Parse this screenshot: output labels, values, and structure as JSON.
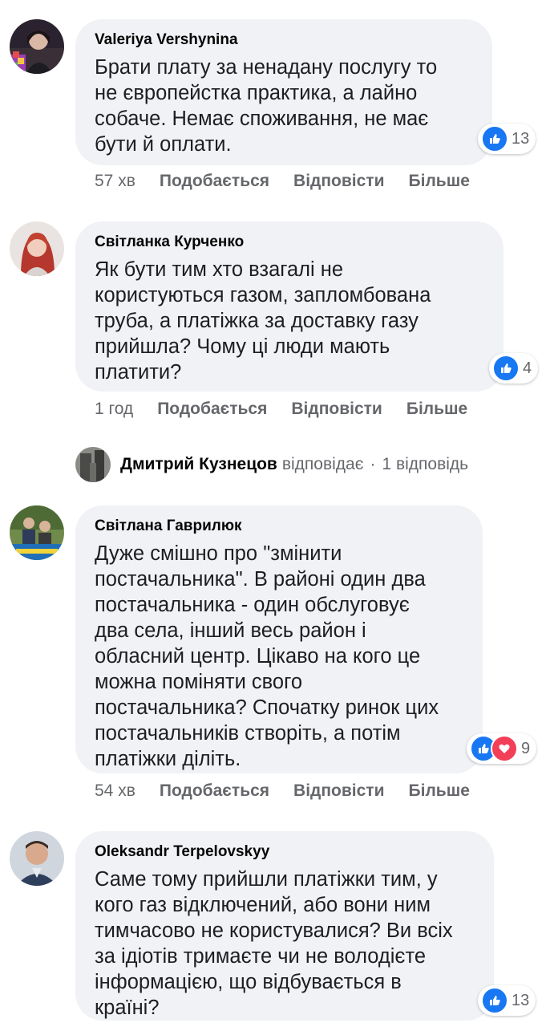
{
  "comments": [
    {
      "author": "Valeriya Vershynina",
      "text": "Брати плату за ненадану послугу то\nне європейстка практика, а лайно\nсобаче. Немає споживання, не має\nбути й оплати.",
      "reaction_count": "13",
      "reactions": [
        "like-icon"
      ],
      "time": "57 хв",
      "like": "Подобається",
      "reply": "Відповісти",
      "more": "Більше"
    },
    {
      "author": "Світланка Курченко",
      "text": "Як бути тим хто взагалі не\nкористуються газом, запломбована\nтруба, а платіжка за доставку газу\nприйшла? Чому ці люди мають\nплатити?",
      "reaction_count": "4",
      "reactions": [
        "like-icon"
      ],
      "time": "1 год",
      "like": "Подобається",
      "reply": "Відповісти",
      "more": "Більше"
    },
    {
      "author": "Світлана Гаврилюк",
      "text": "Дуже смішно про \"змінити\nпостачальника\". В районі один два\nпостачальника - один обслуговує\nдва села, інший весь район і\nобласний центр. Цікаво на кого це\nможна поміняти свого\nпостачальника? Спочатку ринок цих\nпостачальників створіть, а потім\nплатіжки діліть.",
      "reaction_count": "9",
      "reactions": [
        "like-icon",
        "love-icon"
      ],
      "time": "54 хв",
      "like": "Подобається",
      "reply": "Відповісти",
      "more": "Більше"
    },
    {
      "author": "Oleksandr Terpelovskyy",
      "text": "Саме тому прийшли платіжки тим, у\nкого газ відключений, або вони ним\nтимчасово не користувалися? Ви всіх\nза ідіотів тримаєте чи не володієте\nінформацією, що відбувається в\nкраїні?",
      "reaction_count": "13",
      "reactions": [
        "like-icon"
      ]
    }
  ],
  "reply_summary": {
    "name": "Дмитрий Кузнецов",
    "verb": "відповідає",
    "separator": "·",
    "count": "1 відповідь"
  },
  "colors": {
    "bubble": "#f0f2f5",
    "like": "#1877f2",
    "love": "#f33e58",
    "secondary_text": "#65676b"
  }
}
